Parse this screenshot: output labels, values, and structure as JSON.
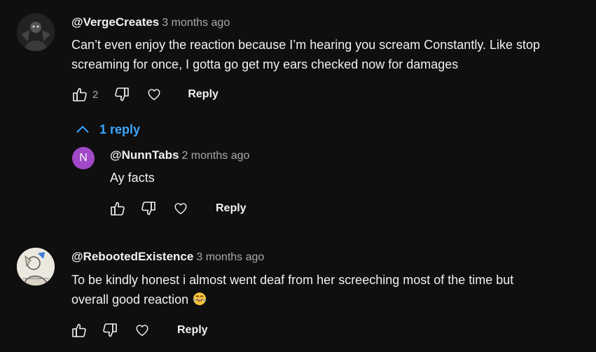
{
  "comments": [
    {
      "handle": "@VergeCreates",
      "time": "3 months ago",
      "text_line1": "Can’t even enjoy the reaction because I’m hearing you scream  Constantly. Like stop",
      "text_line2": "screaming for once, I gotta go get my ears checked now for damages",
      "likes": "2",
      "reply_label": "Reply",
      "replies_toggle": "1 reply",
      "replies": [
        {
          "avatar_letter": "N",
          "avatar_color": "#a149c9",
          "handle": "@NunnTabs",
          "time": "2 months ago",
          "text": "Ay facts",
          "reply_label": "Reply"
        }
      ]
    },
    {
      "handle": "@RebootedExistence",
      "time": "3 months ago",
      "text_line1": "To be kindly honest i almost went deaf from her screeching most of the time but",
      "text_line2": "overall good reaction",
      "emoji": "😂",
      "reply_label": "Reply"
    }
  ],
  "colors": {
    "background": "#0f0f0f",
    "text": "#f1f1f1",
    "secondary": "#aaaaaa",
    "link": "#3ea6ff"
  },
  "icons": [
    "like-icon",
    "dislike-icon",
    "heart-icon",
    "chevron-up-icon"
  ]
}
